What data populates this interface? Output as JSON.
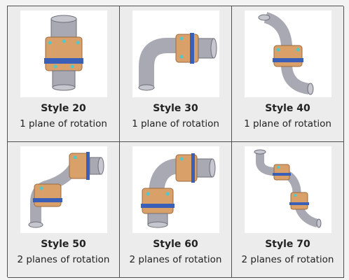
{
  "items": [
    {
      "title": "Style 20",
      "subtitle": "1 plane of rotation"
    },
    {
      "title": "Style 30",
      "subtitle": "1 plane of rotation"
    },
    {
      "title": "Style 40",
      "subtitle": "1 plane of rotation"
    },
    {
      "title": "Style 50",
      "subtitle": "2 planes of rotation"
    },
    {
      "title": "Style 60",
      "subtitle": "2 planes of rotation"
    },
    {
      "title": "Style 70",
      "subtitle": "2 planes of rotation"
    }
  ],
  "colors": {
    "pipe": "#a9a9b4",
    "collar": "#d9a06a",
    "band": "#3a5fb8",
    "bolt": "#4fc9c9",
    "border": "#505050"
  }
}
